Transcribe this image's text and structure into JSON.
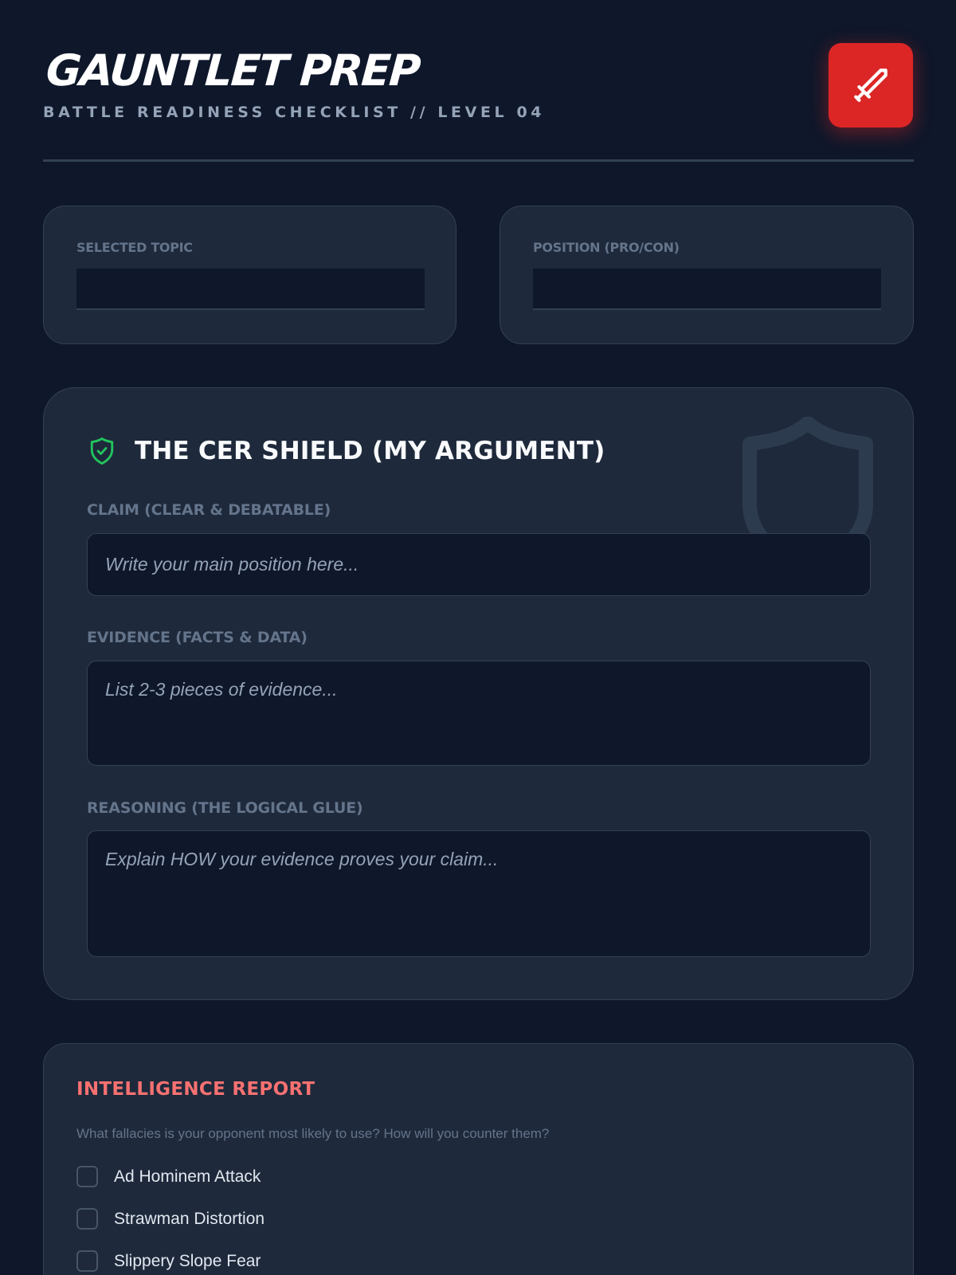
{
  "header": {
    "title": "GAUNTLET PREP",
    "subtitle": "BATTLE READINESS CHECKLIST // LEVEL 04",
    "action_icon": "sword-icon",
    "accent_color": "#dc2626"
  },
  "topic_card": {
    "label": "SELECTED TOPIC",
    "value": ""
  },
  "position_card": {
    "label": "POSITION (PRO/CON)",
    "value": ""
  },
  "cer_shield": {
    "title": "THE CER SHIELD (MY ARGUMENT)",
    "icon": "shield-check-icon",
    "icon_color": "#22c55e",
    "claim": {
      "label": "CLAIM (CLEAR & DEBATABLE)",
      "placeholder": "Write your main position here...",
      "value": ""
    },
    "evidence": {
      "label": "EVIDENCE (FACTS & DATA)",
      "placeholder": "List 2-3 pieces of evidence...",
      "value": ""
    },
    "reasoning": {
      "label": "REASONING (THE LOGICAL GLUE)",
      "placeholder": "Explain HOW your evidence proves your claim...",
      "value": ""
    }
  },
  "intelligence_report": {
    "title": "INTELLIGENCE REPORT",
    "title_color": "#f87171",
    "description": "What fallacies is your opponent most likely to use? How will you counter them?",
    "items": [
      {
        "label": "Ad Hominem Attack",
        "checked": false
      },
      {
        "label": "Strawman Distortion",
        "checked": false
      },
      {
        "label": "Slippery Slope Fear",
        "checked": false
      }
    ]
  }
}
